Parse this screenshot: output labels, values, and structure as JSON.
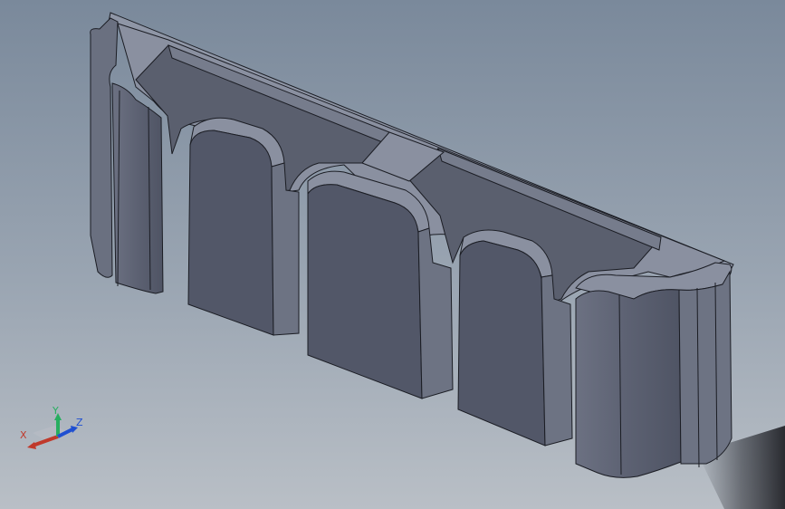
{
  "viewport": {
    "background_top": "#7a899b",
    "background_bottom": "#b9bfc6"
  },
  "model": {
    "face_color": "#5a5f6e",
    "top_color": "#8d93a3",
    "side_color": "#6f7585",
    "edge_color": "#1b1d24"
  },
  "triad": {
    "x_label": "X",
    "y_label": "Y",
    "z_label": "Z",
    "x_color": "#c0392b",
    "y_color": "#27ae60",
    "z_color": "#1f4fd1"
  }
}
